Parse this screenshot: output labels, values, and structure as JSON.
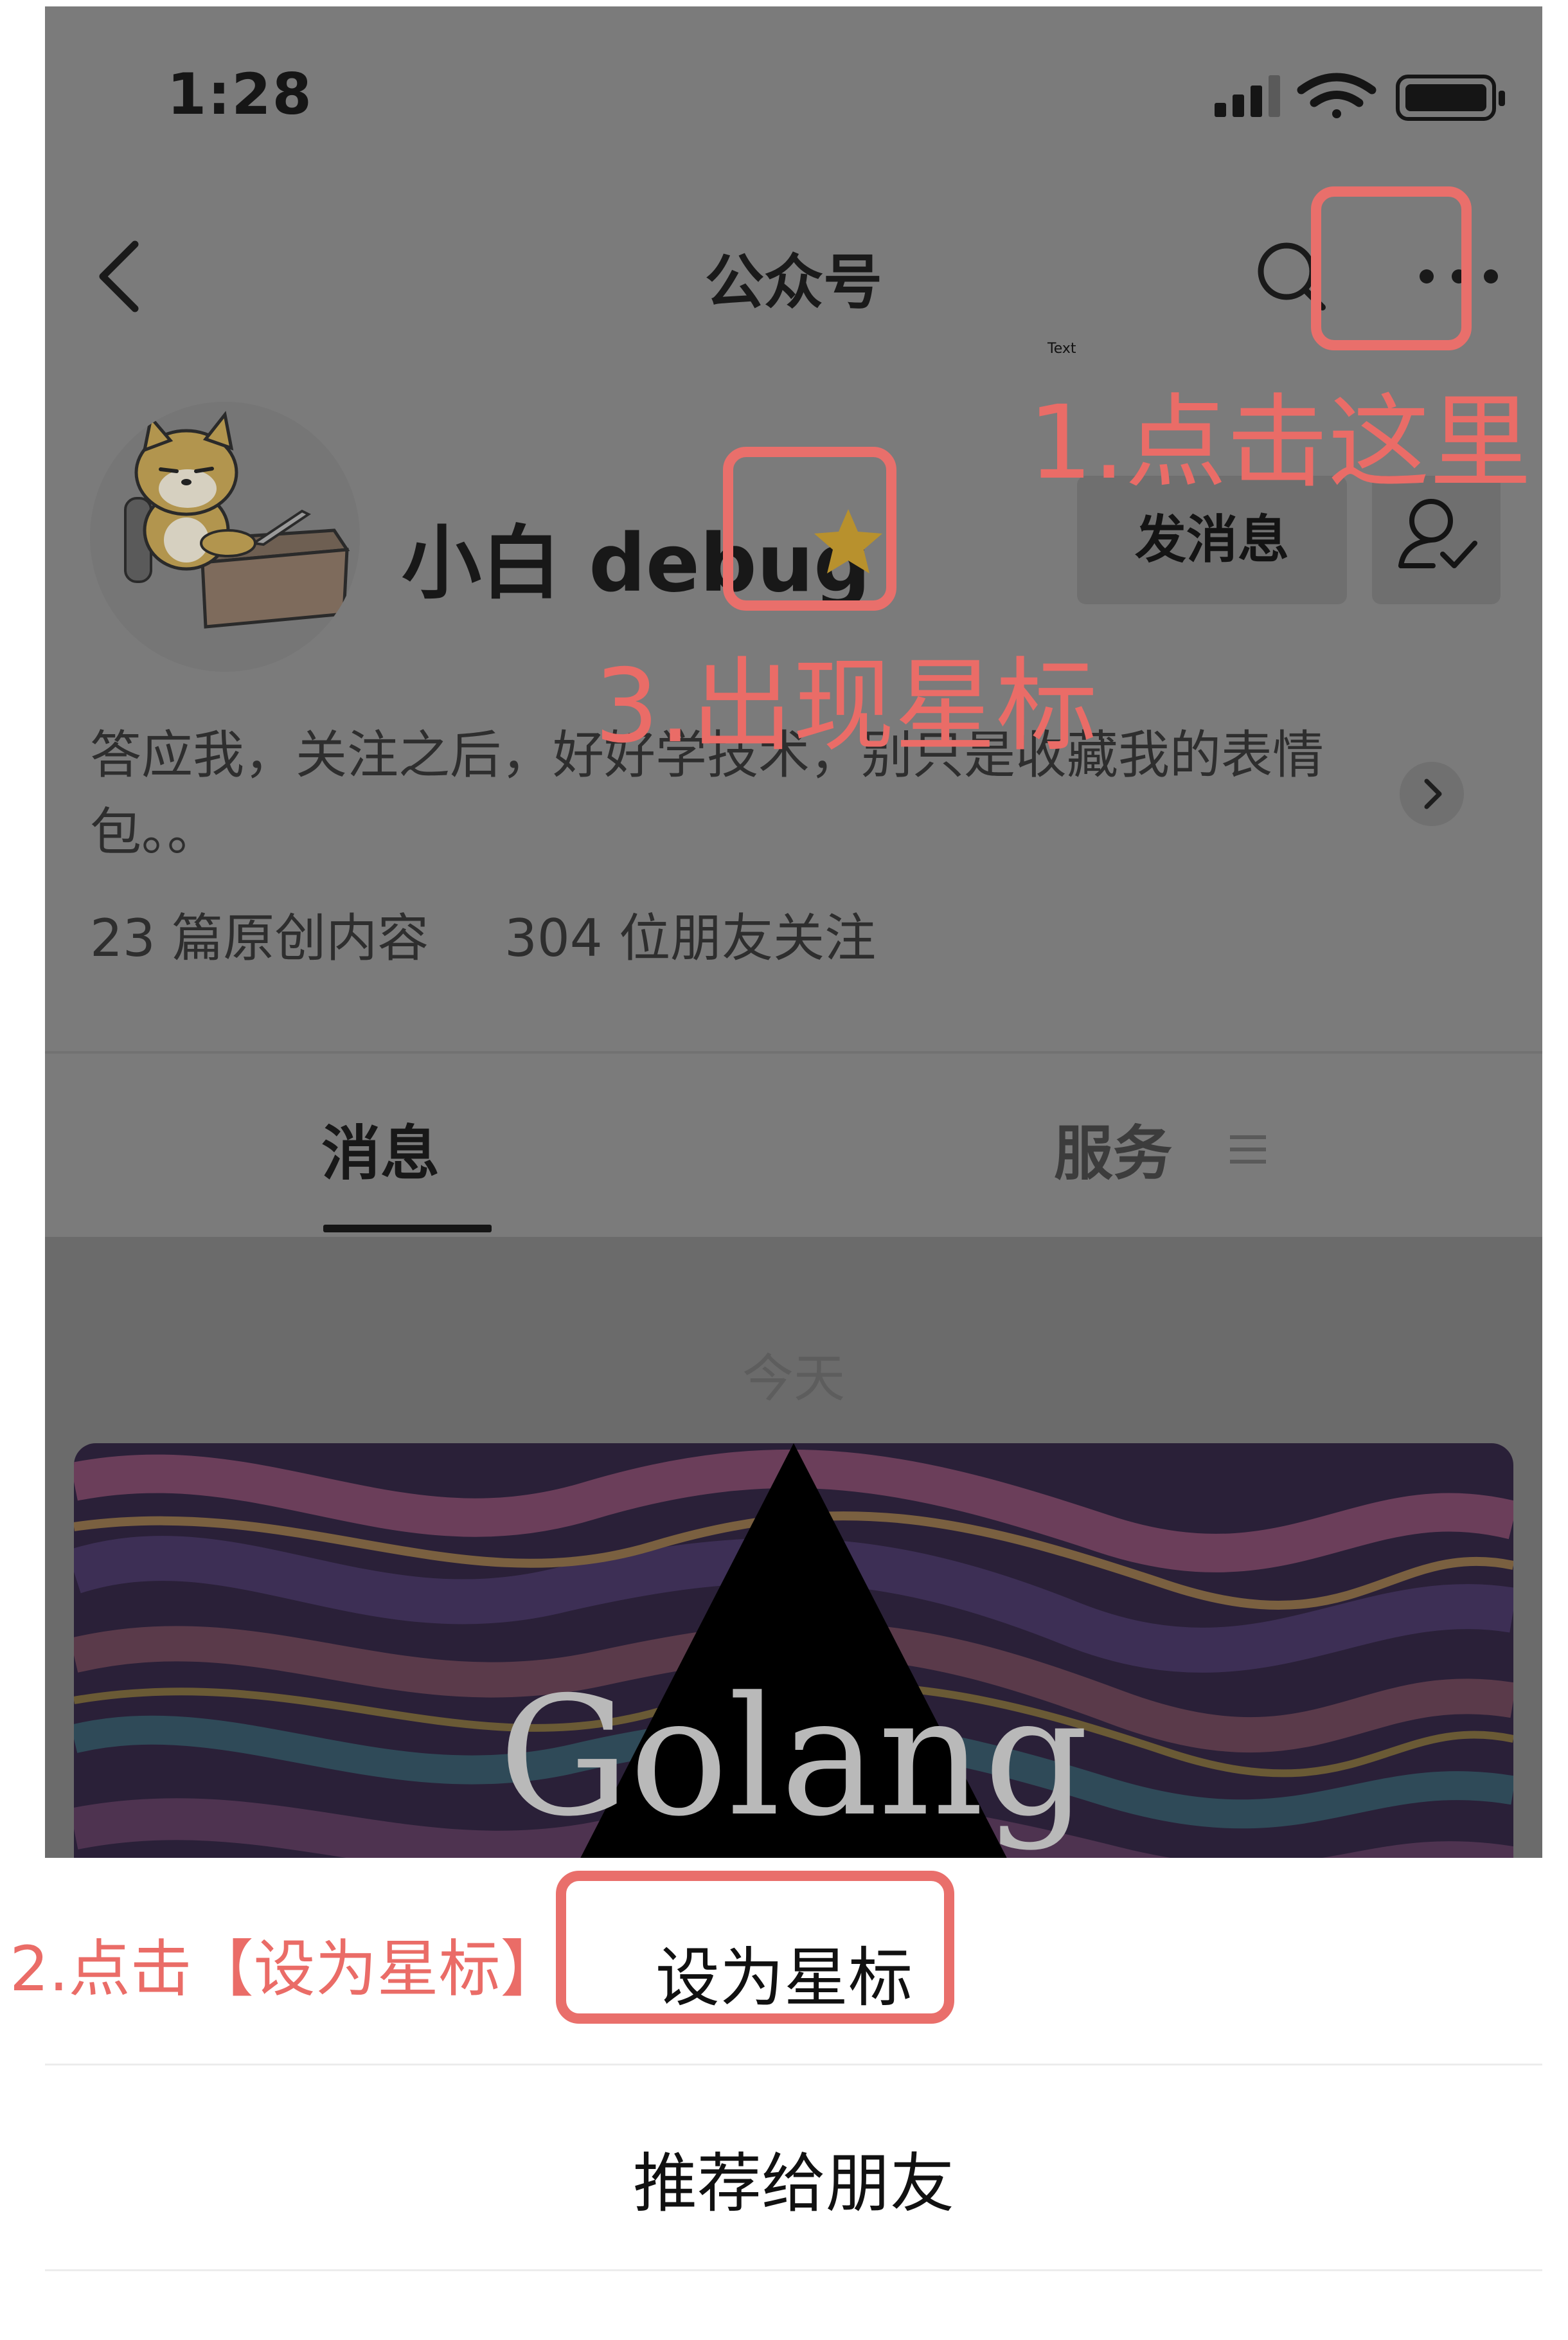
{
  "status_bar": {
    "time": "1:28",
    "icons": [
      "signal-icon",
      "wifi-icon",
      "battery-icon"
    ]
  },
  "nav": {
    "title": "公众号",
    "icons": [
      "back-icon",
      "search-icon",
      "more-icon"
    ]
  },
  "profile": {
    "name": "小白 debug",
    "starred": true,
    "message_button": "发消息",
    "follow_icon": "user-check-icon",
    "bio": "答应我，关注之后，好好学技术，别只是收藏我的表情包。。",
    "stats": {
      "articles": "23 篇原创内容",
      "followers": "304 位朋友关注"
    }
  },
  "tabs": [
    {
      "label": "消息",
      "active": true
    },
    {
      "label": "服务",
      "active": false
    }
  ],
  "feed": {
    "date": "今天",
    "cover_text": "Golang"
  },
  "action_sheet": {
    "options": [
      "设为星标",
      "推荐给朋友"
    ]
  },
  "annotations": {
    "step1": "1.点击这里",
    "step2": "2.点击【设为星标】",
    "step3": "3.出现星标",
    "placeholder": "Text"
  },
  "colors": {
    "annotation": "#e96f6b",
    "star": "#b8912d",
    "dim_background": "#7b7b7b",
    "sheet_background": "#ffffff"
  }
}
